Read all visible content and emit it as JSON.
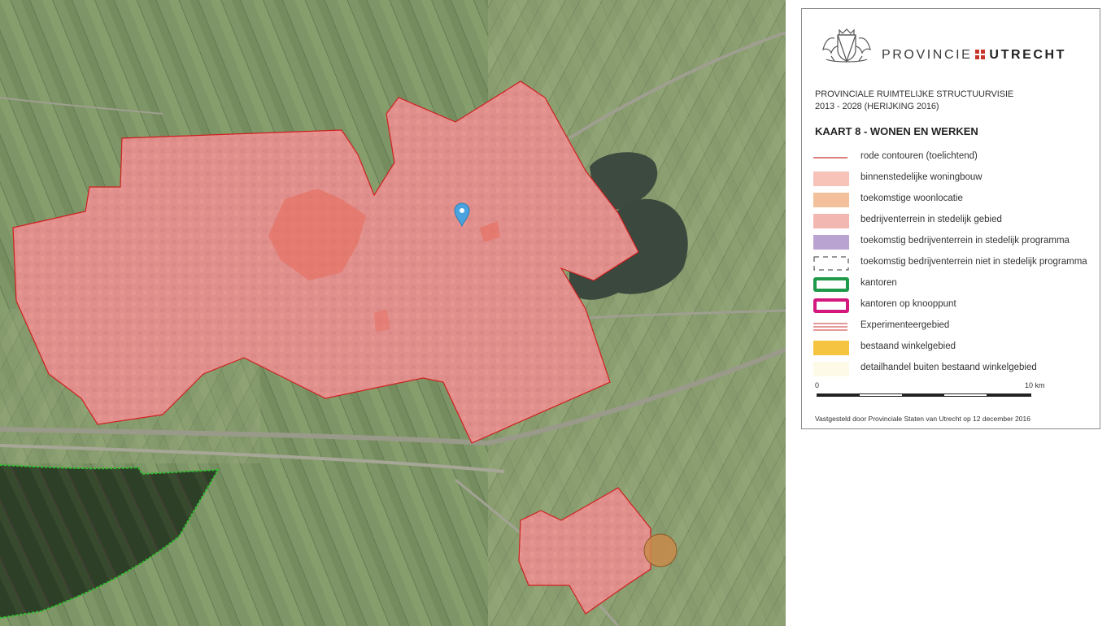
{
  "legend": {
    "brand_prefix": "PROVINCIE",
    "brand_name": "UTRECHT",
    "brand_accent": "#c8352c",
    "subtitle_line1": "PROVINCIALE RUIMTELIJKE STRUCTUURVISIE",
    "subtitle_line2": "2013 - 2028 (HERIJKING 2016)",
    "map_title": "KAART 8 - WONEN EN WERKEN",
    "items": [
      {
        "label": "rode contouren (toelichtend)",
        "color": "#c8352c"
      },
      {
        "label": "binnenstedelijke woningbouw",
        "color": "#f7c3b9"
      },
      {
        "label": "toekomstige woonlocatie",
        "color": "#f4c09b"
      },
      {
        "label": "bedrijventerrein in stedelijk gebied",
        "color": "#f3b7b2"
      },
      {
        "label": "toekomstig bedrijventerrein in stedelijk programma",
        "color": "#b9a4d1"
      },
      {
        "label": "toekomstig bedrijventerrein niet in stedelijk programma",
        "color": "#333333"
      },
      {
        "label": "kantoren",
        "color": "#1e9a4a"
      },
      {
        "label": "kantoren op knooppunt",
        "color": "#d4177e"
      },
      {
        "label": "Experimenteergebied",
        "color": "#c8352c"
      },
      {
        "label": "bestaand winkelgebied",
        "color": "#f5c542"
      },
      {
        "label": "detailhandel buiten bestaand winkelgebied",
        "color": "#fdfbe8"
      }
    ],
    "scale_start": "0",
    "scale_end": "10 km",
    "footer": "Vastgesteld door Provinciale Staten van Utrecht op 12 december 2016"
  },
  "map": {
    "background": "aerial-photo",
    "marker_icon": "map-pin-icon",
    "marker_color": "#4aa3df",
    "urban_fill": "#f08080",
    "future_housing_fill": "#c98a4a",
    "boundary_color": "#2fbf2f"
  }
}
